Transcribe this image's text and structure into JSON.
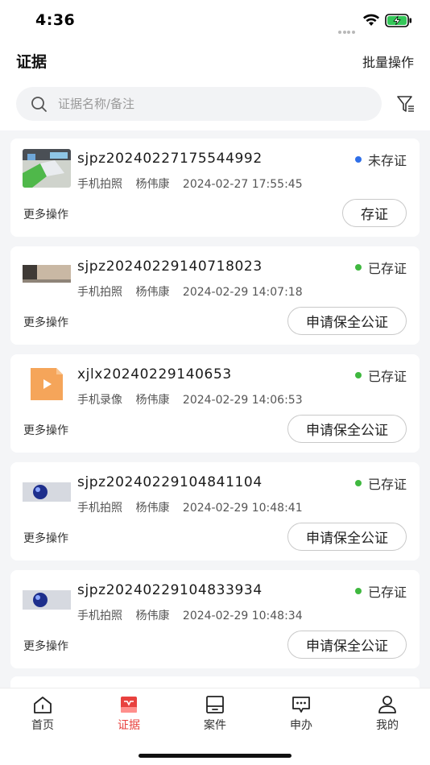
{
  "status_bar": {
    "time": "4:36"
  },
  "header": {
    "title": "证据",
    "batch_label": "批量操作"
  },
  "search": {
    "placeholder": "证据名称/备注"
  },
  "evidence": [
    {
      "name": "sjpz20240227175544992",
      "status": "未存证",
      "status_color": "#2f6fe8",
      "type": "手机拍照",
      "user": "杨伟康",
      "time": "2024-02-27 17:55:45",
      "more": "更多操作",
      "action": "存证",
      "thumb": "photo-green"
    },
    {
      "name": "sjpz20240229140718023",
      "status": "已存证",
      "status_color": "#3fb83f",
      "type": "手机拍照",
      "user": "杨伟康",
      "time": "2024-02-29 14:07:18",
      "more": "更多操作",
      "action": "申请保全公证",
      "thumb": "photo-desk"
    },
    {
      "name": "xjlx20240229140653",
      "status": "已存证",
      "status_color": "#3fb83f",
      "type": "手机录像",
      "user": "杨伟康",
      "time": "2024-02-29 14:06:53",
      "more": "更多操作",
      "action": "申请保全公证",
      "thumb": "video-file"
    },
    {
      "name": "sjpz20240229104841104",
      "status": "已存证",
      "status_color": "#3fb83f",
      "type": "手机拍照",
      "user": "杨伟康",
      "time": "2024-02-29 10:48:41",
      "more": "更多操作",
      "action": "申请保全公证",
      "thumb": "photo-blue"
    },
    {
      "name": "sjpz20240229104833934",
      "status": "已存证",
      "status_color": "#3fb83f",
      "type": "手机拍照",
      "user": "杨伟康",
      "time": "2024-02-29 10:48:34",
      "more": "更多操作",
      "action": "申请保全公证",
      "thumb": "photo-blue"
    }
  ],
  "tabbar": {
    "items": [
      {
        "label": "首页",
        "icon": "home-icon"
      },
      {
        "label": "证据",
        "icon": "evidence-icon",
        "active": true
      },
      {
        "label": "案件",
        "icon": "case-icon"
      },
      {
        "label": "申办",
        "icon": "apply-icon"
      },
      {
        "label": "我的",
        "icon": "profile-icon"
      }
    ]
  },
  "colors": {
    "accent": "#e8413e",
    "pending": "#2f6fe8",
    "done": "#3fb83f"
  }
}
